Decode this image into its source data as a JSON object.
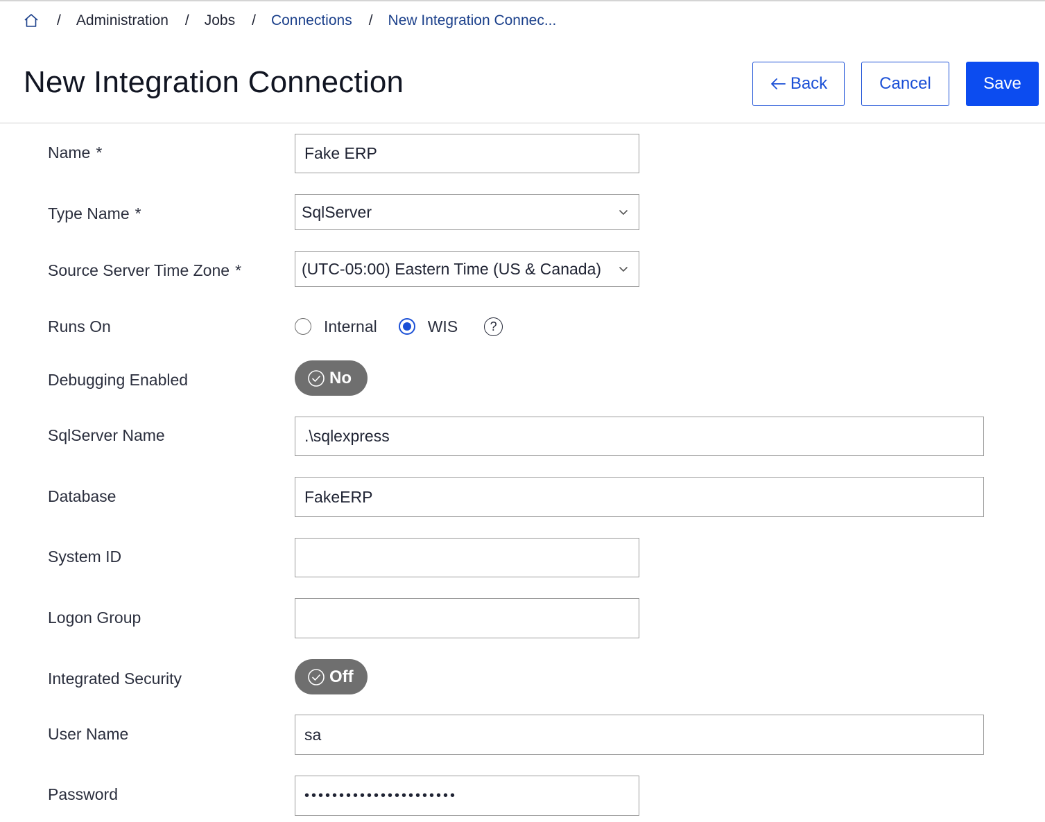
{
  "breadcrumb": {
    "home_icon": "home-icon",
    "items": [
      {
        "label": "Administration"
      },
      {
        "label": "Jobs"
      },
      {
        "label": "Connections"
      },
      {
        "label": "New Integration Connec..."
      }
    ]
  },
  "header": {
    "title": "New Integration Connection",
    "back_label": "Back",
    "cancel_label": "Cancel",
    "save_label": "Save"
  },
  "colors": {
    "primary": "#0c4cf0",
    "toggle_bg": "#6f6f6f",
    "link": "#1a3f8a"
  },
  "form": {
    "name": {
      "label": "Name",
      "required": "*",
      "value": "Fake ERP"
    },
    "type_name": {
      "label": "Type Name",
      "required": "*",
      "value": "SqlServer"
    },
    "time_zone": {
      "label": "Source Server Time Zone",
      "required": "*",
      "value": "(UTC-05:00) Eastern Time (US & Canada)"
    },
    "runs_on": {
      "label": "Runs On",
      "options": [
        "Internal",
        "WIS"
      ],
      "selected": "WIS"
    },
    "debugging": {
      "label": "Debugging Enabled",
      "value": "No"
    },
    "sqlserver_name": {
      "label": "SqlServer Name",
      "value": ".\\sqlexpress"
    },
    "database": {
      "label": "Database",
      "value": "FakeERP"
    },
    "system_id": {
      "label": "System ID",
      "value": ""
    },
    "logon_group": {
      "label": "Logon Group",
      "value": ""
    },
    "integrated_security": {
      "label": "Integrated Security",
      "value": "Off"
    },
    "user_name": {
      "label": "User Name",
      "value": "sa"
    },
    "password": {
      "label": "Password",
      "value": "••••••••••••••••••••••"
    }
  }
}
